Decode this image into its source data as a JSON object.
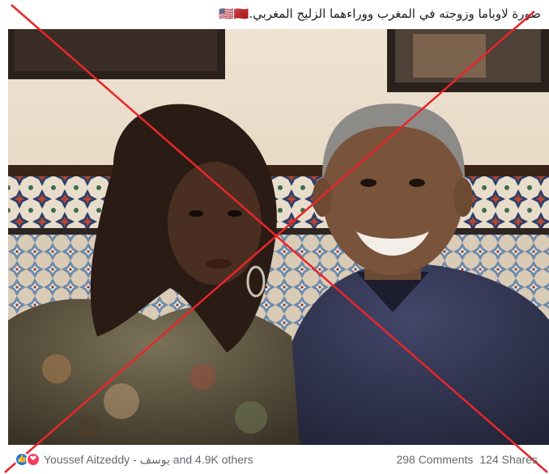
{
  "post": {
    "text": "صورة لاوباما وزوجته في المغرب ووراءهما الزليج المغربي.🇺🇸🇲🇦"
  },
  "photo": {
    "icon": "photo"
  },
  "overlay": {
    "color": "#e8262a"
  },
  "footer": {
    "reaction_icons": [
      "like-icon",
      "love-icon"
    ],
    "reactors": "Youssef Aitzeddy - يوسف and 4.9K others",
    "comments": "298 Comments",
    "shares": "124 Shares"
  }
}
